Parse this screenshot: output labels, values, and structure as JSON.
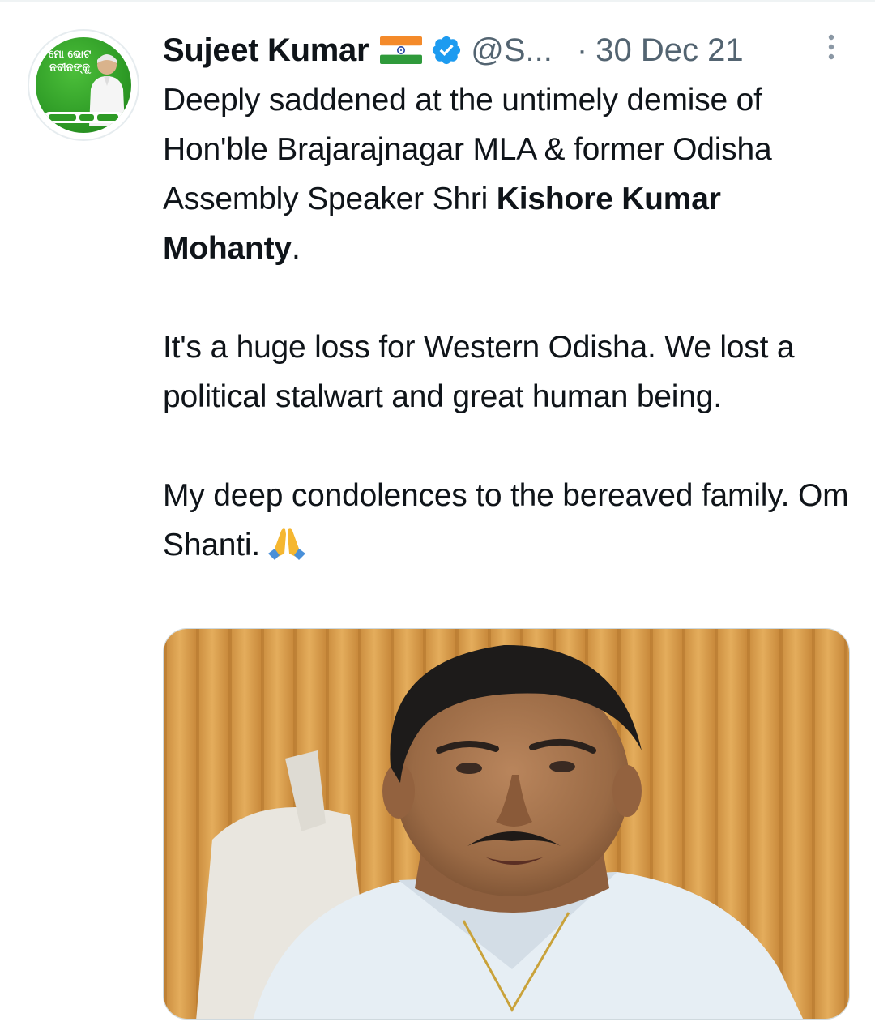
{
  "tweet": {
    "author": {
      "display_name": "Sujeet Kumar",
      "handle": "@S...",
      "avatar_text": "ମୋ ଭୋଟ ନବୀନଙ୍କୁ"
    },
    "separator": "·",
    "date": "30 Dec 21",
    "body": {
      "p1_text": "Deeply saddened at the untimely demise of Hon'ble Brajarajnagar MLA & former Odisha Assembly Speaker Shri ",
      "p1_bold": "Kishore Kumar Mohanty",
      "p1_end": ".",
      "p2": "It's a huge loss for Western Odisha. We lost a political stalwart and great human being.",
      "p3": "My deep condolences to the bereaved family. Om Shanti."
    },
    "icons": {
      "flag": "india-flag-icon",
      "verified": "verified-badge-icon",
      "more": "more-vertical-icon",
      "emoji": "folded-hands-icon"
    },
    "colors": {
      "verified": "#1d9bf0",
      "secondary_text": "#536471",
      "avatar_green": "#2e9b26"
    }
  }
}
